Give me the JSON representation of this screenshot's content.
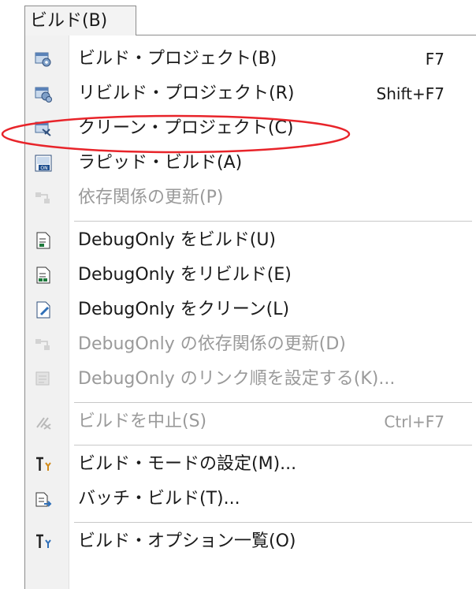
{
  "menu": {
    "title": "ビルド(B)",
    "items": [
      {
        "label": "ビルド・プロジェクト(B)",
        "shortcut": "F7",
        "icon": "build-project-icon",
        "enabled": true
      },
      {
        "label": "リビルド・プロジェクト(R)",
        "shortcut": "Shift+F7",
        "icon": "rebuild-project-icon",
        "enabled": true
      },
      {
        "label": "クリーン・プロジェクト(C)",
        "shortcut": "",
        "icon": "clean-project-icon",
        "enabled": true,
        "highlighted": true
      },
      {
        "label": "ラピッド・ビルド(A)",
        "shortcut": "",
        "icon": "rapid-build-icon",
        "enabled": true
      },
      {
        "label": "依存関係の更新(P)",
        "shortcut": "",
        "icon": "update-dependencies-icon",
        "enabled": false
      },
      {
        "label": "DebugOnly をビルド(U)",
        "shortcut": "",
        "icon": "build-file-icon",
        "enabled": true
      },
      {
        "label": "DebugOnly をリビルド(E)",
        "shortcut": "",
        "icon": "rebuild-file-icon",
        "enabled": true
      },
      {
        "label": "DebugOnly をクリーン(L)",
        "shortcut": "",
        "icon": "clean-file-icon",
        "enabled": true
      },
      {
        "label": "DebugOnly の依存関係の更新(D)",
        "shortcut": "",
        "icon": "update-dependencies-icon",
        "enabled": false
      },
      {
        "label": "DebugOnly のリンク順を設定する(K)...",
        "shortcut": "",
        "icon": "link-order-icon",
        "enabled": false
      },
      {
        "label": "ビルドを中止(S)",
        "shortcut": "Ctrl+F7",
        "icon": "stop-build-icon",
        "enabled": false
      },
      {
        "label": "ビルド・モードの設定(M)...",
        "shortcut": "",
        "icon": "build-mode-icon",
        "enabled": true
      },
      {
        "label": "バッチ・ビルド(T)...",
        "shortcut": "",
        "icon": "batch-build-icon",
        "enabled": true
      },
      {
        "label": "ビルド・オプション一覧(O)",
        "shortcut": "",
        "icon": "build-options-icon",
        "enabled": true
      }
    ]
  },
  "colors": {
    "highlight": "#e8242a",
    "disabled_text": "#9a9a9a"
  }
}
